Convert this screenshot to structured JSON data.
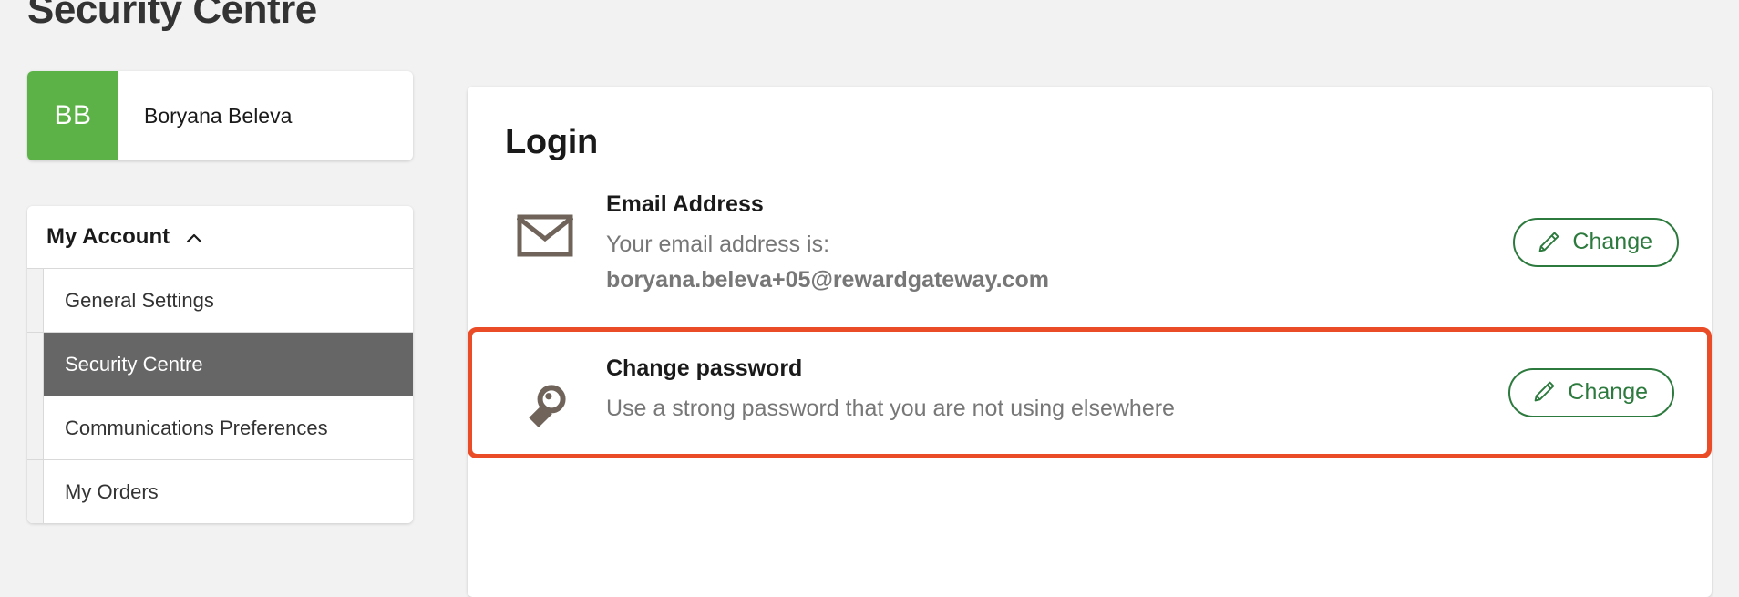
{
  "page": {
    "title": "Security Centre"
  },
  "profile": {
    "initials": "BB",
    "name": "Boryana Beleva",
    "avatar_color": "#5cb247"
  },
  "sidebar": {
    "header": {
      "label": "My Account",
      "chevron_icon": "chevron-up-icon",
      "expanded": true
    },
    "items": [
      {
        "label": "General Settings",
        "active": false
      },
      {
        "label": "Security Centre",
        "active": true
      },
      {
        "label": "Communications Preferences",
        "active": false
      },
      {
        "label": "My Orders",
        "active": false
      }
    ],
    "active_color": "#666666"
  },
  "main": {
    "heading": "Login",
    "rows": [
      {
        "id": "email-address",
        "icon": "envelope-icon",
        "title": "Email Address",
        "subtitle": "Your email address is:",
        "value": "boryana.beleva+05@rewardgateway.com",
        "action_label": "Change",
        "action_icon": "pencil-icon",
        "highlighted": false
      },
      {
        "id": "change-password",
        "icon": "key-icon",
        "title": "Change password",
        "subtitle": "Use a strong password that you are not using elsewhere",
        "value": "",
        "action_label": "Change",
        "action_icon": "pencil-icon",
        "highlighted": true
      }
    ]
  },
  "colors": {
    "page_background": "#f2f2f2",
    "card_background": "#ffffff",
    "accent_green": "#2d7a3e",
    "avatar_green": "#5cb247",
    "highlight_outline": "#ea4c27",
    "icon_taupe": "#6f635a",
    "muted_text": "#777777",
    "heading_text": "#1a1a1a"
  }
}
